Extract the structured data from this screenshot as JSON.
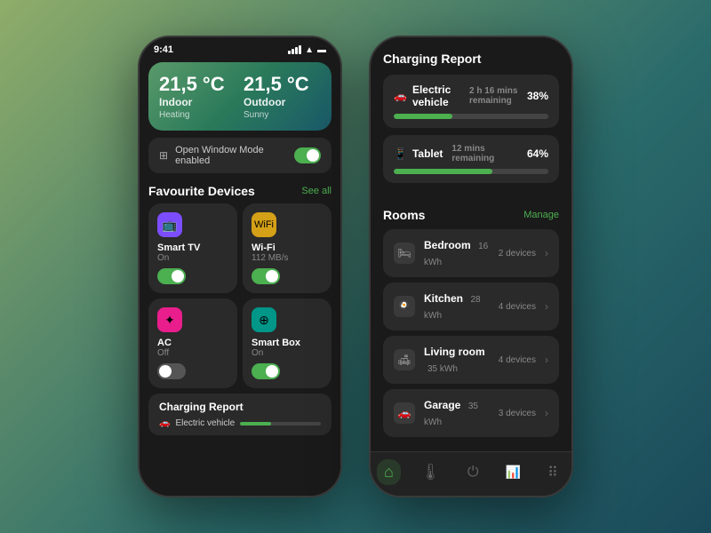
{
  "background": {
    "gradient": "linear-gradient(135deg, #8fad6a 0%, #5a8a6a 30%, #2a6b6b 60%, #1a4a5a 100%)"
  },
  "left_phone": {
    "status_bar": {
      "time": "9:41"
    },
    "weather": {
      "indoor_temp": "21,5 °C",
      "indoor_label": "Indoor",
      "indoor_sub": "Heating",
      "outdoor_temp": "21,5 °C",
      "outdoor_label": "Outdoor",
      "outdoor_sub": "Sunny"
    },
    "window_mode": {
      "label": "Open Window Mode enabled"
    },
    "favourite_devices": {
      "title": "Favourite Devices",
      "see_all": "See all",
      "devices": [
        {
          "name": "Smart TV",
          "status": "On",
          "icon": "📺",
          "icon_class": "icon-purple",
          "toggle": "on"
        },
        {
          "name": "Wi-Fi",
          "status": "112 MB/s",
          "icon": "📶",
          "icon_class": "icon-gold",
          "toggle": "on"
        },
        {
          "name": "AC",
          "status": "Off",
          "icon": "❄️",
          "icon_class": "icon-pink",
          "toggle": "off"
        },
        {
          "name": "Smart Box",
          "status": "On",
          "icon": "⊕",
          "icon_class": "icon-teal",
          "toggle": "on"
        }
      ]
    },
    "charging_report_mini": {
      "title": "Charging Report",
      "item": {
        "name": "Electric vehicle",
        "time": "2 h 16 mins remaining",
        "percent": 38
      }
    }
  },
  "right_phone": {
    "charging_report": {
      "title": "Charging Report",
      "items": [
        {
          "icon": "🚗",
          "name": "Electric vehicle",
          "time": "2 h 16 mins remaining",
          "percent": 38,
          "percent_label": "38%"
        },
        {
          "icon": "📱",
          "name": "Tablet",
          "time": "12 mins remaining",
          "percent": 64,
          "percent_label": "64%"
        }
      ]
    },
    "rooms": {
      "title": "Rooms",
      "manage": "Manage",
      "items": [
        {
          "icon": "🛏",
          "name": "Bedroom",
          "kwh": "16 kWh",
          "devices": "2 devices"
        },
        {
          "icon": "🍳",
          "name": "Kitchen",
          "kwh": "28 kWh",
          "devices": "4 devices"
        },
        {
          "icon": "🛋",
          "name": "Living room",
          "kwh": "35 kWh",
          "devices": "4 devices"
        },
        {
          "icon": "🚗",
          "name": "Garage",
          "kwh": "35 kWh",
          "devices": "3 devices"
        }
      ]
    },
    "nav": {
      "items": [
        {
          "icon": "⌂",
          "label": "home",
          "active": true
        },
        {
          "icon": "🌡",
          "label": "temperature",
          "active": false
        },
        {
          "icon": "⏻",
          "label": "power",
          "active": false
        },
        {
          "icon": "📊",
          "label": "stats",
          "active": false
        },
        {
          "icon": "⠿",
          "label": "devices",
          "active": false
        }
      ]
    }
  }
}
